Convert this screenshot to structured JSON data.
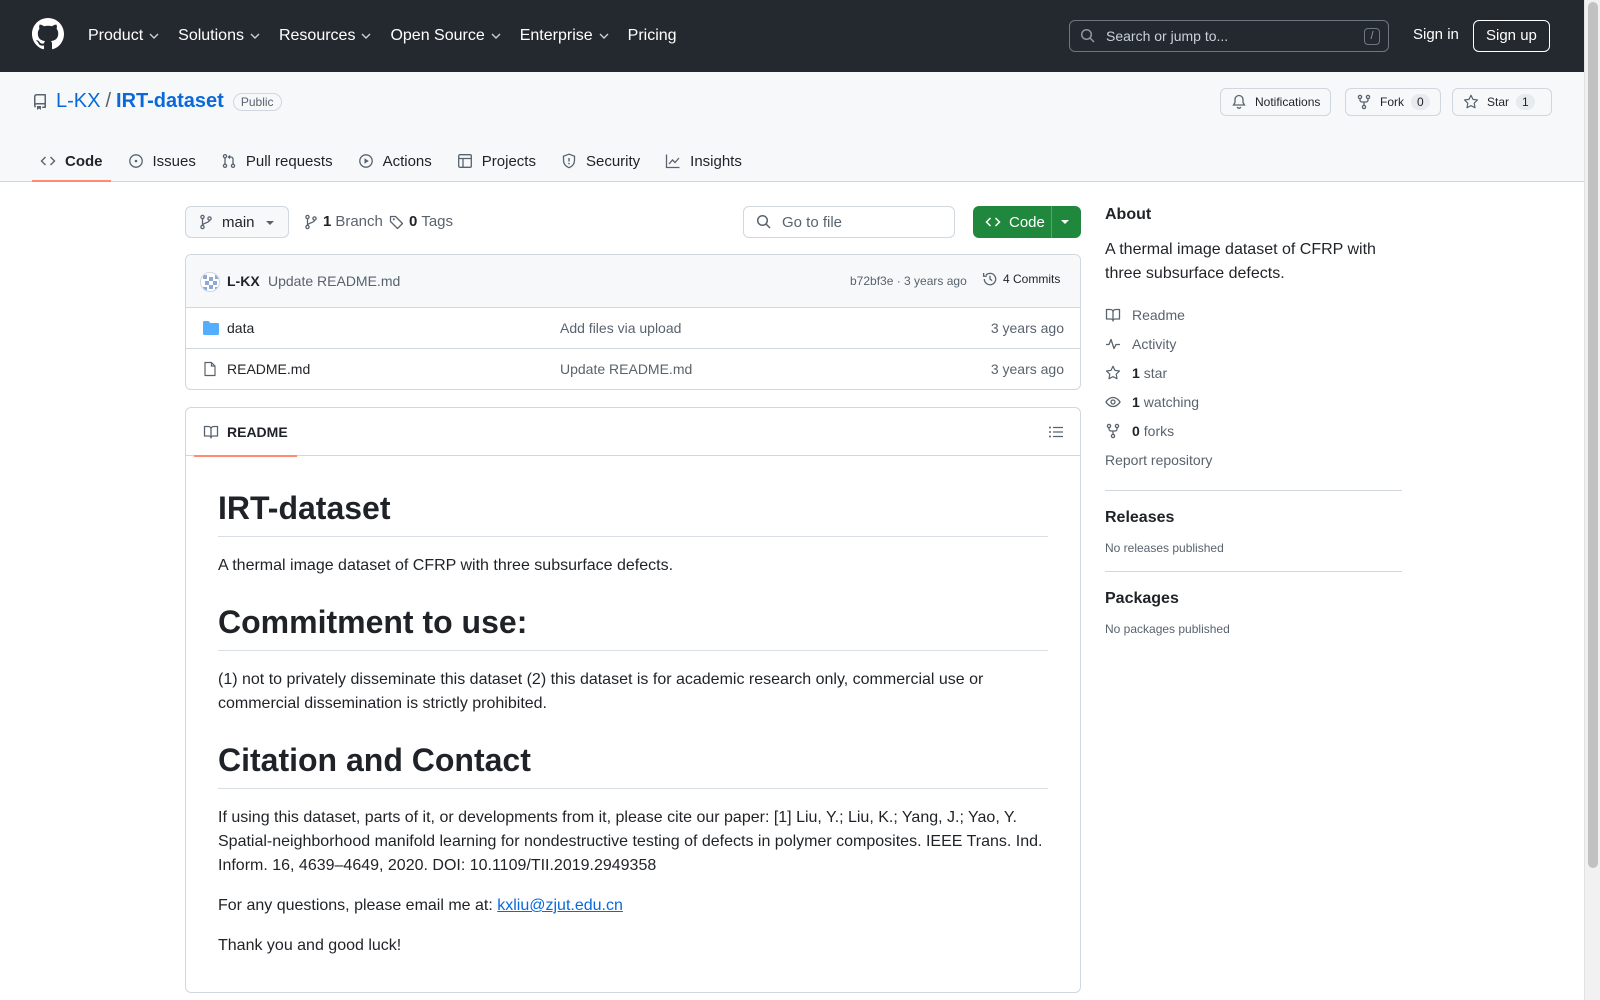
{
  "header": {
    "nav": [
      "Product",
      "Solutions",
      "Resources",
      "Open Source",
      "Enterprise",
      "Pricing"
    ],
    "search_placeholder": "Search or jump to...",
    "search_shortcut": "/",
    "signin": "Sign in",
    "signup": "Sign up"
  },
  "repo": {
    "owner": "L-KX",
    "separator": "/",
    "name": "IRT-dataset",
    "visibility": "Public",
    "notifications_label": "Notifications",
    "fork_label": "Fork",
    "fork_count": "0",
    "star_label": "Star",
    "star_count": "1"
  },
  "tabs": [
    {
      "label": "Code",
      "icon": "code-icon",
      "active": true
    },
    {
      "label": "Issues",
      "icon": "issue-icon"
    },
    {
      "label": "Pull requests",
      "icon": "pull-request-icon"
    },
    {
      "label": "Actions",
      "icon": "play-icon"
    },
    {
      "label": "Projects",
      "icon": "table-icon"
    },
    {
      "label": "Security",
      "icon": "shield-icon"
    },
    {
      "label": "Insights",
      "icon": "graph-icon"
    }
  ],
  "toolbar": {
    "branch": "main",
    "branch_count": "1",
    "branch_label": "Branch",
    "tag_count": "0",
    "tag_label": "Tags",
    "goto_placeholder": "Go to file",
    "code_button": "Code"
  },
  "latest_commit": {
    "author": "L-KX",
    "message": "Update README.md",
    "sha_time": "b72bf3e · 3 years ago",
    "commits": "4 Commits"
  },
  "files": [
    {
      "name": "data",
      "type": "folder",
      "message": "Add files via upload",
      "date": "3 years ago"
    },
    {
      "name": "README.md",
      "type": "file",
      "message": "Update README.md",
      "date": "3 years ago"
    }
  ],
  "readme": {
    "tab_label": "README",
    "title": "IRT-dataset",
    "intro": "A thermal image dataset of CFRP with three subsurface defects.",
    "h_commitment": "Commitment to use:",
    "commitment": "(1) not to privately disseminate this dataset (2) this dataset is for academic research only, commercial use or commercial dissemination is strictly prohibited.",
    "h_citation": "Citation and Contact",
    "citation": "If using this dataset, parts of it, or developments from it, please cite our paper: [1] Liu, Y.; Liu, K.; Yang, J.; Yao, Y. Spatial-neighborhood manifold learning for nondestructive testing of defects in polymer composites. IEEE Trans. Ind. Inform. 16, 4639–4649, 2020. DOI: 10.1109/TII.2019.2949358",
    "contact_prefix": "For any questions, please email me at: ",
    "email": "kxliu@zjut.edu.cn",
    "closing": "Thank you and good luck!"
  },
  "sidebar": {
    "about_title": "About",
    "about_desc": "A thermal image dataset of CFRP with three subsurface defects.",
    "readme": "Readme",
    "activity": "Activity",
    "stars_count": "1",
    "stars_label": "star",
    "watching_count": "1",
    "watching_label": "watching",
    "forks_count": "0",
    "forks_label": "forks",
    "report": "Report repository",
    "releases_title": "Releases",
    "releases_none": "No releases published",
    "packages_title": "Packages",
    "packages_none": "No packages published"
  },
  "colors": {
    "header_bg": "#24292f",
    "link": "#0969da",
    "primary_button": "#1f883d",
    "active_tab_underline": "#fd8c73"
  }
}
